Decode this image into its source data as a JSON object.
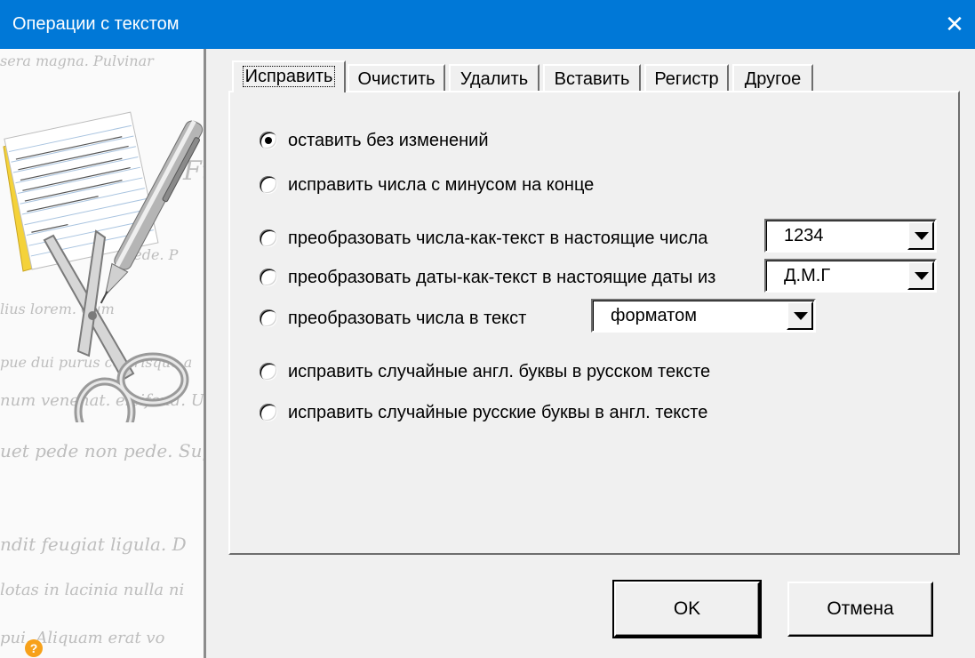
{
  "window": {
    "title": "Операции с текстом",
    "close_glyph": "✕"
  },
  "sidebar": {
    "script_lines": [
      "sera magna. Pulvinar",
      "Ft",
      "pede. P",
      "lius lorem. Cum",
      "pue dui purus celerisque a",
      "num venenat. eleifend. U",
      "uet pede non pede. Sup",
      "ndit feugiat ligula. D",
      "lotas in lacinia nulla ni",
      "pui. Aliquam erat vo"
    ],
    "help_glyph": "?"
  },
  "tabs": [
    "Исправить",
    "Очистить",
    "Удалить",
    "Вставить",
    "Регистр",
    "Другое"
  ],
  "options": [
    "оставить без изменений",
    "исправить числа с минусом на конце",
    "преобразовать числа-как-текст в настоящие числа",
    "преобразовать даты-как-текст в настоящие даты из",
    "преобразовать числа в текст",
    "исправить случайные англ. буквы в русском тексте",
    "исправить случайные русские буквы в англ. тексте"
  ],
  "selected_option": 0,
  "combos": {
    "number_format": "1234",
    "date_format": "Д.М.Г",
    "text_mode": "форматом"
  },
  "buttons": {
    "ok": "OK",
    "cancel": "Отмена"
  }
}
